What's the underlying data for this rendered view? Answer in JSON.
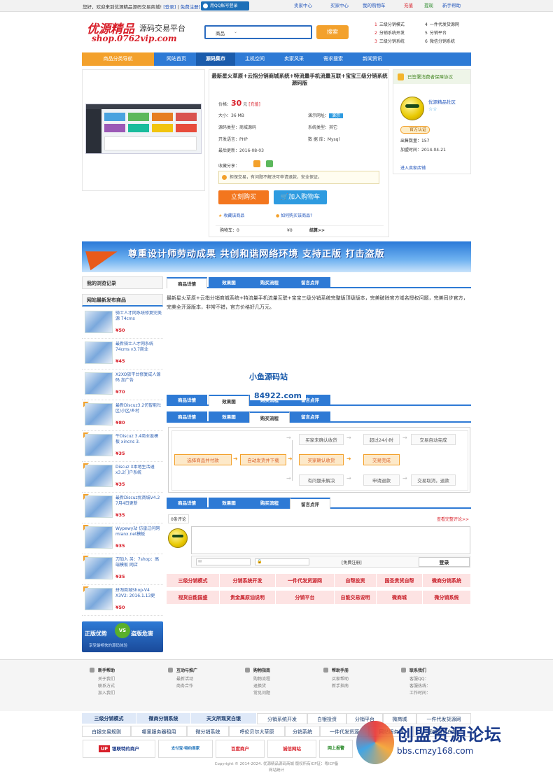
{
  "topbar": {
    "welcome_prefix": "您好，欢迎来到",
    "site_name": "优源精品源码交易商城",
    "welcome_suffix": "!",
    "login": "[登录]",
    "register": "免费注册]",
    "qq_login": "用QQ账号登录",
    "seller_center": "卖家中心",
    "buyer_center": "买家中心",
    "cart": "我的购物车",
    "recharge": "充值",
    "withdraw": "提现",
    "help": "新手帮助"
  },
  "logo": {
    "brand": "优源精品",
    "tagline": "源码交易平台",
    "url": "shop.0762vip.com"
  },
  "search": {
    "category": "商品",
    "button": "搜索"
  },
  "steps": [
    {
      "n": "1",
      "t": "三级分销模式"
    },
    {
      "n": "2",
      "t": "分销系统开发"
    },
    {
      "n": "3",
      "t": "三级分销系统"
    },
    {
      "n": "4",
      "t": "一件代发货源网"
    },
    {
      "n": "5",
      "t": "分销平台"
    },
    {
      "n": "6",
      "t": "微信分销系统"
    }
  ],
  "nav": {
    "category": "商品分类导航",
    "items": [
      "网站首页",
      "源码集市",
      "主机空间",
      "卖家风采",
      "需求搜索",
      "新闻资讯"
    ]
  },
  "product": {
    "title": "最新星火草原+云指分销商城系统+特流量手机流量互联+宝宝三级分销系统源码版",
    "price_label": "价格：",
    "price": "30",
    "price_unit": "元",
    "recharge": "[充值]",
    "size_label": "大小：",
    "size": "36 MB",
    "demo_label": "演示网址：",
    "demo": "演示",
    "type_label": "源码类型：",
    "type": "商城源码",
    "os_label": "系统类型：",
    "os": "其它",
    "lang_label": "开发语言：",
    "lang": "PHP",
    "db_label": "数 据 库：",
    "db": "Mysql",
    "date_label": "最后更新：",
    "date": "2016-08-03",
    "share_label": "收藏分享：",
    "safe_text": "担保交易，有问题不解决可申请退款，安全保证。",
    "buy": "立刻购买",
    "add_cart": "加入购物车",
    "fav": "收藏该商品",
    "how_buy": "如何购买该商品?",
    "cart_label": "购物车",
    "cart_count": "0",
    "cart_total_label": "¥",
    "cart_total": "0",
    "checkout": "结算>>"
  },
  "seller": {
    "header": "已签署消费者保障协议",
    "name": "优源精品社区",
    "level": "☆☆",
    "badge": "官方认证",
    "sold_label": "出售数量：",
    "sold": "157",
    "join_label": "加盟时间：",
    "join": "2014-04-21",
    "enter": "进入卖家店铺"
  },
  "banner": {
    "text": "尊重设计师劳动成果 共创和谐网络环境 支持正版 打击盗版"
  },
  "sidebar": {
    "history": "我的浏览记录",
    "recommend": "网站最新发布商品",
    "items": [
      {
        "name": "骑士人才网系统修复完美源 74cms",
        "price": "¥50"
      },
      {
        "name": "最新骑士人才网系统74cms v3.7商业",
        "price": "¥45"
      },
      {
        "name": "X2XO旅平台修复成人源码 加广告",
        "price": "¥70"
      },
      {
        "name": "最新Discuz3.2仿智能社区/小区/乡村",
        "price": "¥80"
      },
      {
        "name": "牛Discuz 3.4商业股模板 xincns 3.",
        "price": "¥35"
      },
      {
        "name": "Discuz X本地生活通x3.2门户系统",
        "price": "¥35"
      },
      {
        "name": "最新Discuz优商城V4.2 7月4日更新",
        "price": "¥35"
      },
      {
        "name": "Wypewy站 仿雷过问网 mianx.net模板",
        "price": "¥35"
      },
      {
        "name": "刀加入 另：7shop：高端模板 网店",
        "price": "¥35"
      },
      {
        "name": "拼淘商城Shop-V4 X3V2: 2016.1.13更",
        "price": "¥50"
      }
    ],
    "vs_a": "正版优势",
    "vs_b": "盗版危害",
    "vs": "VS",
    "vs_sub": "享受最畅快的源码体验"
  },
  "tabs": [
    "商品详情",
    "效果图",
    "购买流程",
    "留言点评"
  ],
  "description": "最新星火草原+云指分销商城系统+特流量手机流量互联+宝宝三级分销系统完整版顶级版本，完美破除官方域名授权问题，完美同步官方，完美全开源版本，非常不错，官方价格好几万元。",
  "watermark": {
    "name": "小鱼源码站",
    "url": "84922.com"
  },
  "flow": {
    "select": "选择商品并付款",
    "auto_ship": "自动发货并下载",
    "confirm": "买家确认收货",
    "done": "交易完成",
    "unconfirmed": "买家未确认收货",
    "after24": "超过24小时",
    "auto_done": "交易自动完成",
    "problem": "有问题未解决",
    "refund": "申请退款",
    "cancel": "交易取消，退款"
  },
  "comments": {
    "count": "0条评论",
    "view_all": "查看完整评论>>",
    "register": "[免费注册]",
    "submit": "登录"
  },
  "keywords": [
    [
      "三级分销模式",
      "分销系统开发",
      "一件代发货源网",
      "自帮投资",
      "国圣贵货自帮",
      "微商分销系统"
    ],
    [
      "视货自能国盛",
      "贵金属原油说明",
      "分销平台",
      "自能交易说明",
      "微商城",
      "微分销系统"
    ]
  ],
  "footer": {
    "cols": [
      {
        "h": "新手帮助",
        "l": [
          "关于我们",
          "联系方式",
          "加入我们"
        ]
      },
      {
        "h": "互动与推广",
        "l": [
          "最新活动",
          "商务合作"
        ]
      },
      {
        "h": "购物指南",
        "l": [
          "购物流程",
          "退换货",
          "常见问题"
        ]
      },
      {
        "h": "帮助手册",
        "l": [
          "买家帮助",
          "新手指南"
        ]
      },
      {
        "h": "联系我们",
        "l": [
          "客服QQ：  ",
          "客服热线：  ",
          "工作时间：  "
        ]
      }
    ],
    "kw1": [
      "三级分销模式",
      "微商分销系统",
      "天文所现货白银",
      "分销系统开发",
      "白银投资",
      "分销平台",
      "微商城",
      "一件代发货源网"
    ],
    "kw2": [
      "白银交易规则",
      "哪里服务器租用",
      "微分销系统",
      "呼伦贝尔大草原",
      "分销系统",
      "一件代发货源",
      "网站服务器",
      "国盛贵货白银"
    ],
    "badges": [
      "银联特约商户",
      "支付宝·特约商家",
      "百度商户",
      "诚信网站",
      "诚信网站",
      "网上报警"
    ],
    "copyright": "Copyright © 2014-2024. 优源精品源码商城 版权所有ICP证：粤ICP备",
    "stats": "网站统计"
  },
  "site_watermark": {
    "name": "创盟资源论坛",
    "url": "bbs.cmzy168.com"
  }
}
